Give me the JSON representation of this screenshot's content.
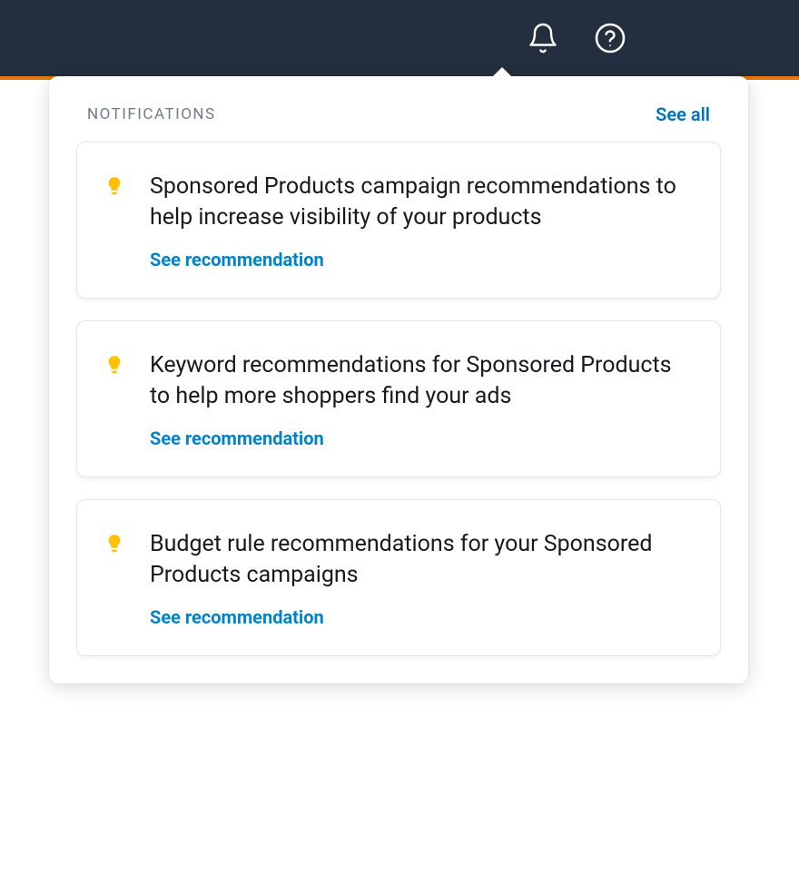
{
  "notifications": {
    "header_label": "NOTIFICATIONS",
    "see_all_label": "See all",
    "items": [
      {
        "icon": "lightbulb",
        "title": "Sponsored Products campaign recommendations to help increase visibility of your products",
        "action_label": "See recommendation"
      },
      {
        "icon": "lightbulb",
        "title": "Keyword recommendations for Sponsored Products to help more shoppers find your ads",
        "action_label": "See recommendation"
      },
      {
        "icon": "lightbulb",
        "title": "Budget rule recommendations for your Sponsored Products campaigns",
        "action_label": "See recommendation"
      }
    ]
  },
  "colors": {
    "topbar_bg": "#232f3e",
    "accent_orange": "#e47911",
    "link_blue": "#0073bb",
    "icon_yellow": "#ffc107"
  }
}
